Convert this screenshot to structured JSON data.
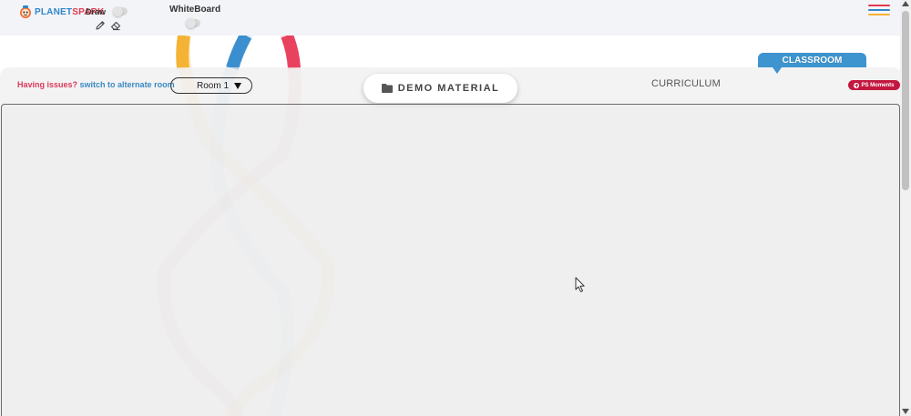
{
  "brand": {
    "planet": "PLANET",
    "spark": "SPARK"
  },
  "toolbar": {
    "draw_label": "Draw",
    "whiteboard_label": "WhiteBoard"
  },
  "notice": {
    "question": "Having issues?",
    "link": "switch to alternate room"
  },
  "room_select": {
    "selected": "Room 1"
  },
  "demo_button": {
    "label": "DEMO MATERIAL"
  },
  "curriculum": {
    "label": "CURRICULUM"
  },
  "classroom_tab": {
    "label": "CLASSROOM"
  },
  "ps_moments": {
    "label": "PS Moments"
  },
  "icons": {
    "draw": "pencil-icon",
    "erase": "eraser-icon",
    "menu": "hamburger-menu-icon",
    "folder": "folder-icon",
    "add": "plus-circle-icon",
    "select": "caret-down-icon"
  },
  "colors": {
    "brand_blue": "#2f86c9",
    "brand_red": "#e0394e",
    "classroom_blue": "#3d94ce",
    "ps_moments_red": "#c2183f",
    "swirl_yellow": "#f5b335",
    "swirl_blue": "#3b8fcf",
    "swirl_red": "#e8425e"
  }
}
